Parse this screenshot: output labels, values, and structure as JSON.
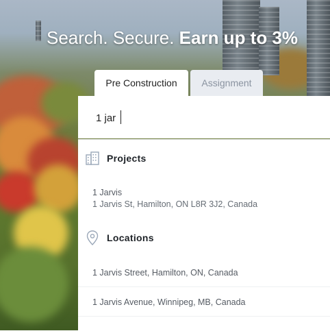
{
  "hero": {
    "headline_light": "Search. Secure. ",
    "headline_bold": "Earn up to 3%"
  },
  "tabs": [
    {
      "label": "Pre Construction",
      "active": true
    },
    {
      "label": "Assignment",
      "active": false
    }
  ],
  "search": {
    "value": "1 jar",
    "placeholder": ""
  },
  "results": {
    "projects": {
      "heading": "Projects",
      "icon": "building-icon",
      "items": [
        {
          "name": "1 Jarvis",
          "address": "1 Jarvis St, Hamilton, ON L8R 3J2, Canada"
        }
      ]
    },
    "locations": {
      "heading": "Locations",
      "icon": "map-pin-icon",
      "items": [
        {
          "label": "1 Jarvis Street, Hamilton, ON, Canada"
        },
        {
          "label": "1 Jarvis Avenue, Winnipeg, MB, Canada"
        }
      ]
    }
  },
  "colors": {
    "panel": "#ffffff",
    "inactive_tab": "#e9ecf1",
    "icon": "#9aa7b8"
  }
}
